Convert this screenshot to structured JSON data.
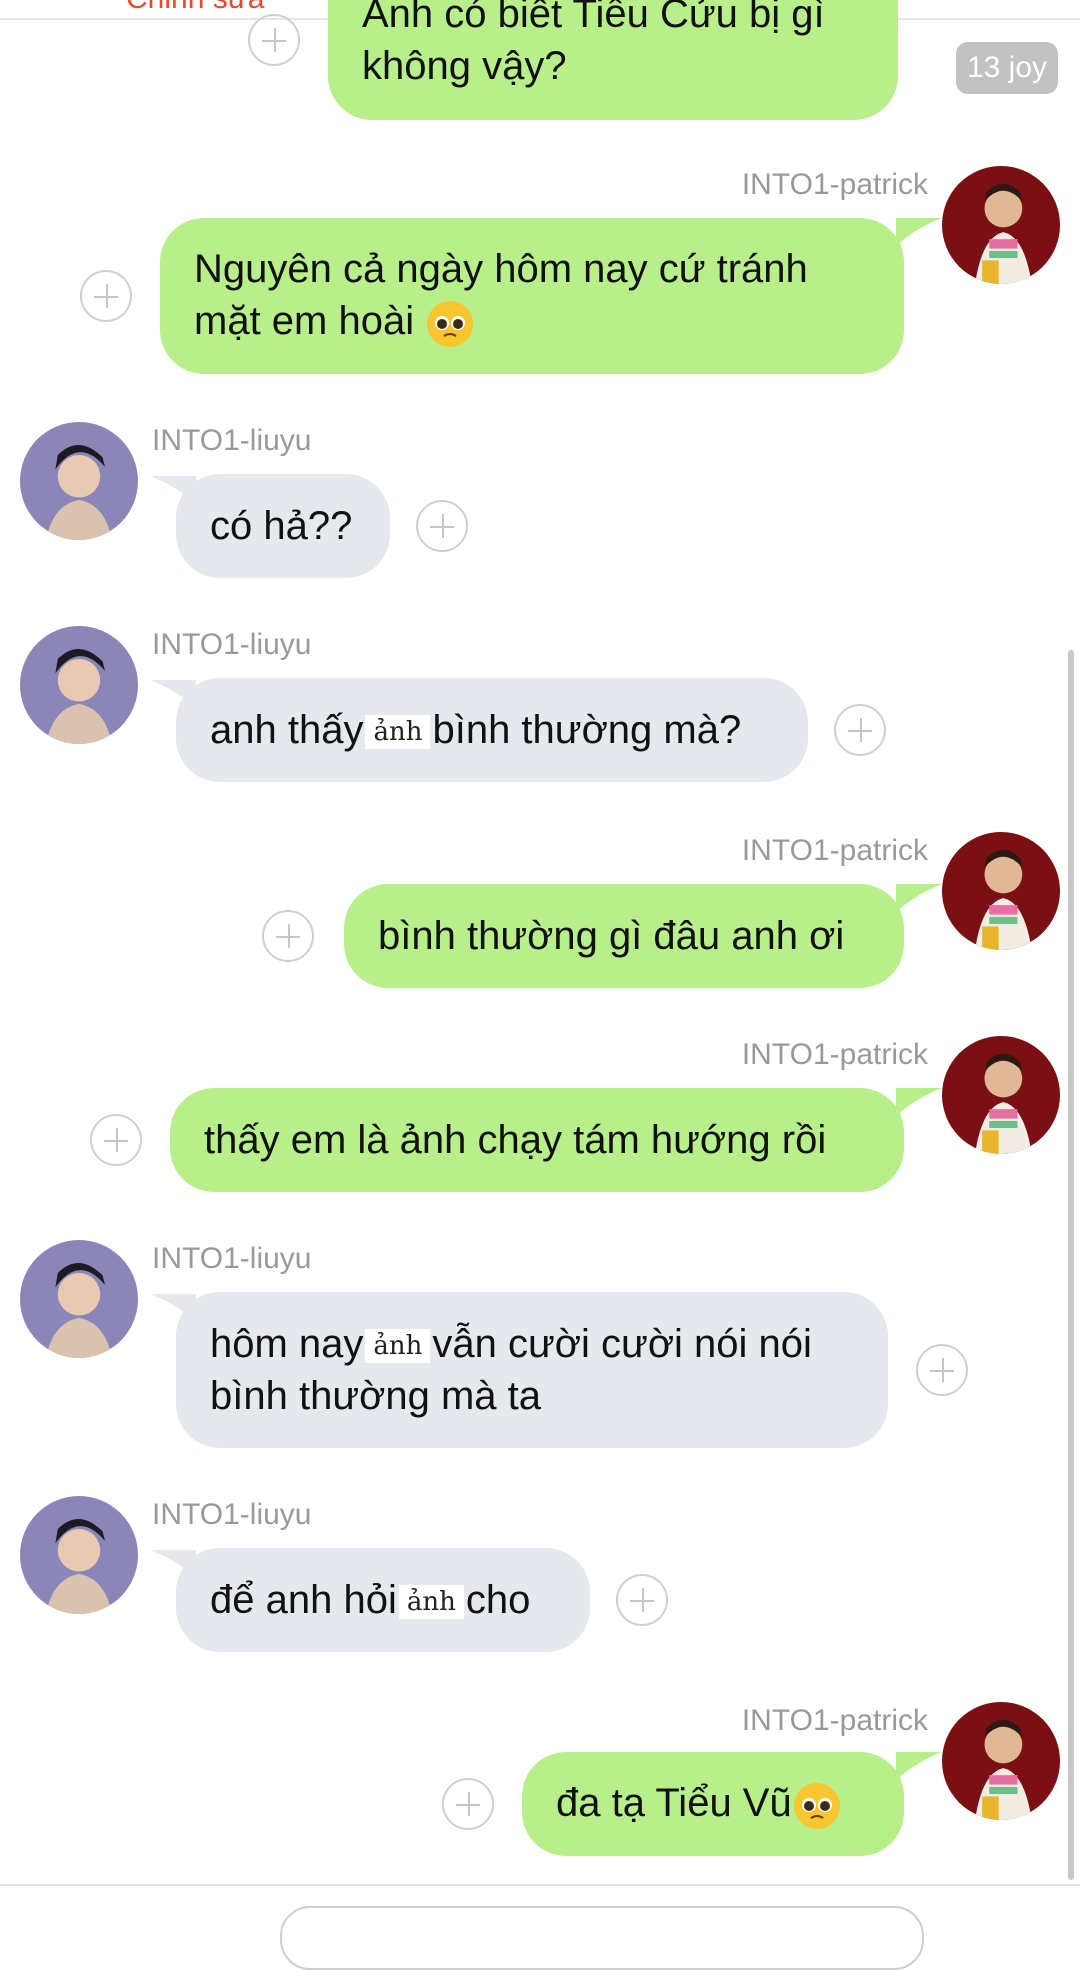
{
  "header": {
    "edit_label": "Chỉnh sửa"
  },
  "reaction_badge": "13 joy",
  "senders": {
    "patrick": "INTO1-patrick",
    "liuyu": "INTO1-liuyu"
  },
  "messages": [
    {
      "sender": "patrick",
      "line1": "Anh có biết Tiểu Cửu bị gì",
      "line2": "không vậy?"
    },
    {
      "sender": "patrick",
      "line1": "Nguyên cả ngày hôm nay cứ tránh",
      "line2": "mặt em hoài"
    },
    {
      "sender": "liuyu",
      "text": "có hả??"
    },
    {
      "sender": "liuyu",
      "before": "anh thấy",
      "inline": "ảnh",
      "after": "bình thường mà?"
    },
    {
      "sender": "patrick",
      "text": "bình thường gì đâu anh ơi"
    },
    {
      "sender": "patrick",
      "text": "thấy em là ảnh chạy tám hướng rồi"
    },
    {
      "sender": "liuyu",
      "before": "hôm nay",
      "inline": "ảnh",
      "after": "vẫn cười cười nói nói",
      "line2": "bình thường mà ta"
    },
    {
      "sender": "liuyu",
      "before": "để anh hỏi",
      "inline": "ảnh",
      "after": "cho"
    },
    {
      "sender": "patrick",
      "text": "đa tạ Tiểu Vũ"
    }
  ],
  "colors": {
    "my_bubble": "#b8ef8a",
    "other_bubble": "#e5e8ec",
    "sender_name": "#999999"
  }
}
